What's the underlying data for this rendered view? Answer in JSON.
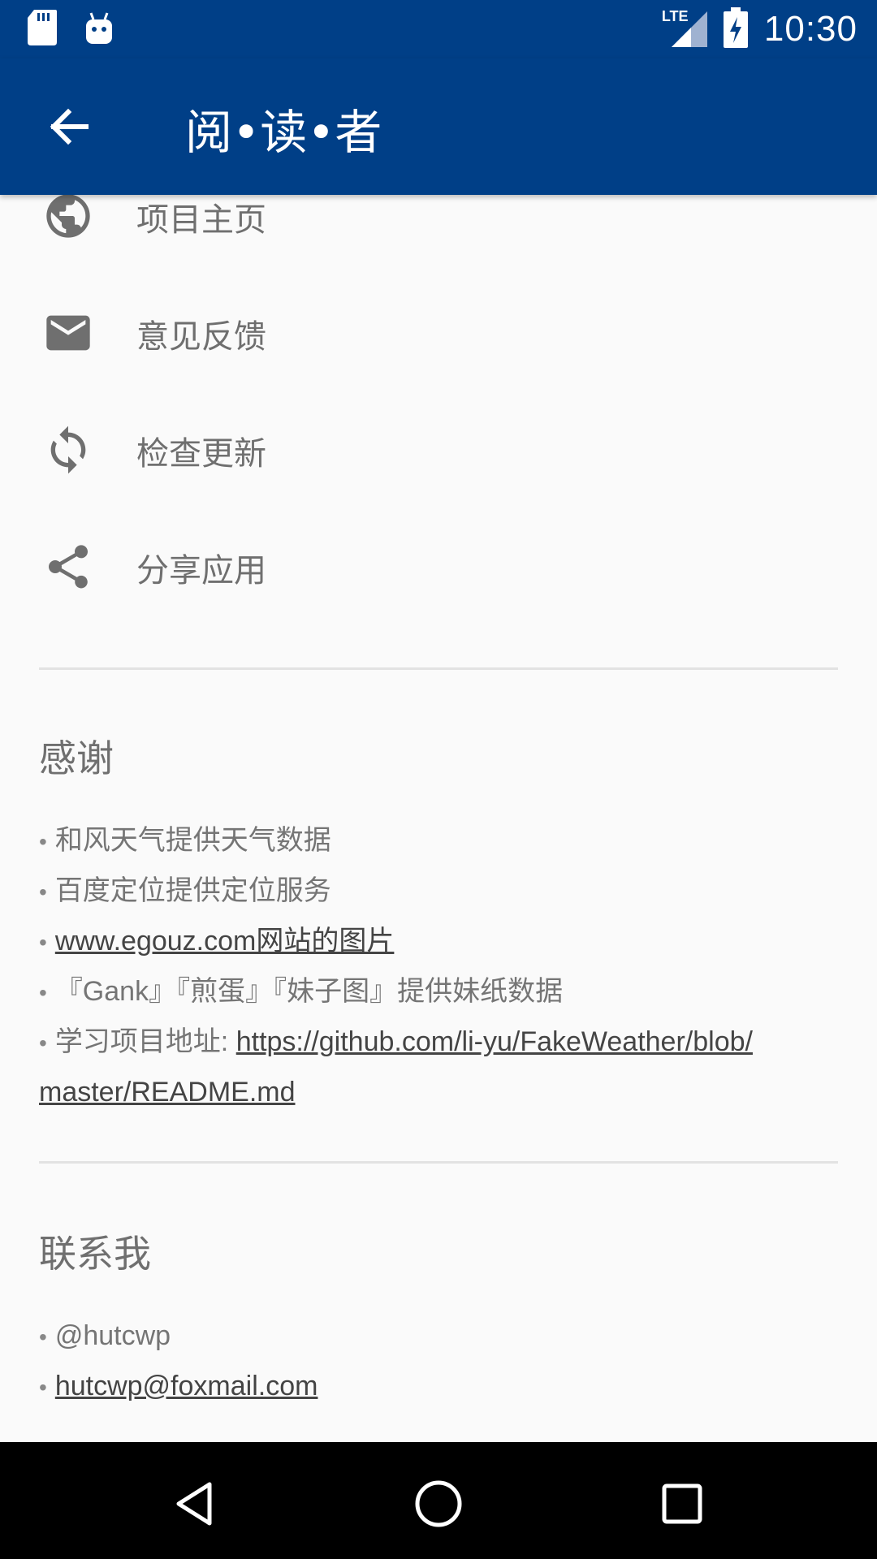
{
  "status_bar": {
    "time": "10:30",
    "network": "LTE",
    "icons": [
      "sd-card-icon",
      "android-icon",
      "signal-icon",
      "battery-charging-icon"
    ]
  },
  "app_bar": {
    "back_icon": "arrow-back-icon",
    "title": "阅•读•者"
  },
  "menu": [
    {
      "icon": "globe-icon",
      "label": "项目主页"
    },
    {
      "icon": "mail-icon",
      "label": "意见反馈"
    },
    {
      "icon": "sync-icon",
      "label": "检查更新"
    },
    {
      "icon": "share-icon",
      "label": "分享应用"
    }
  ],
  "thanks": {
    "title": "感谢",
    "items": [
      {
        "text": "和风天气提供天气数据"
      },
      {
        "text": "百度定位提供定位服务"
      },
      {
        "link": "www.egouz.com网站的图片"
      },
      {
        "text": "『Gank』『煎蛋』『妹子图』提供妹纸数据"
      },
      {
        "prefix": "学习项目地址: ",
        "link_part1": "https://github.com/li-yu/FakeWeather/blob/",
        "link_part2": "master/README.md"
      }
    ]
  },
  "contact": {
    "title": "联系我",
    "items": [
      {
        "text": "@hutcwp"
      },
      {
        "link": "hutcwp@foxmail.com"
      }
    ]
  },
  "nav_bar": {
    "buttons": [
      "back-triangle-icon",
      "home-circle-icon",
      "recents-square-icon"
    ]
  },
  "colors": {
    "primary": "#003f87",
    "background": "#fafafa",
    "text_secondary": "#6f6f6f"
  }
}
